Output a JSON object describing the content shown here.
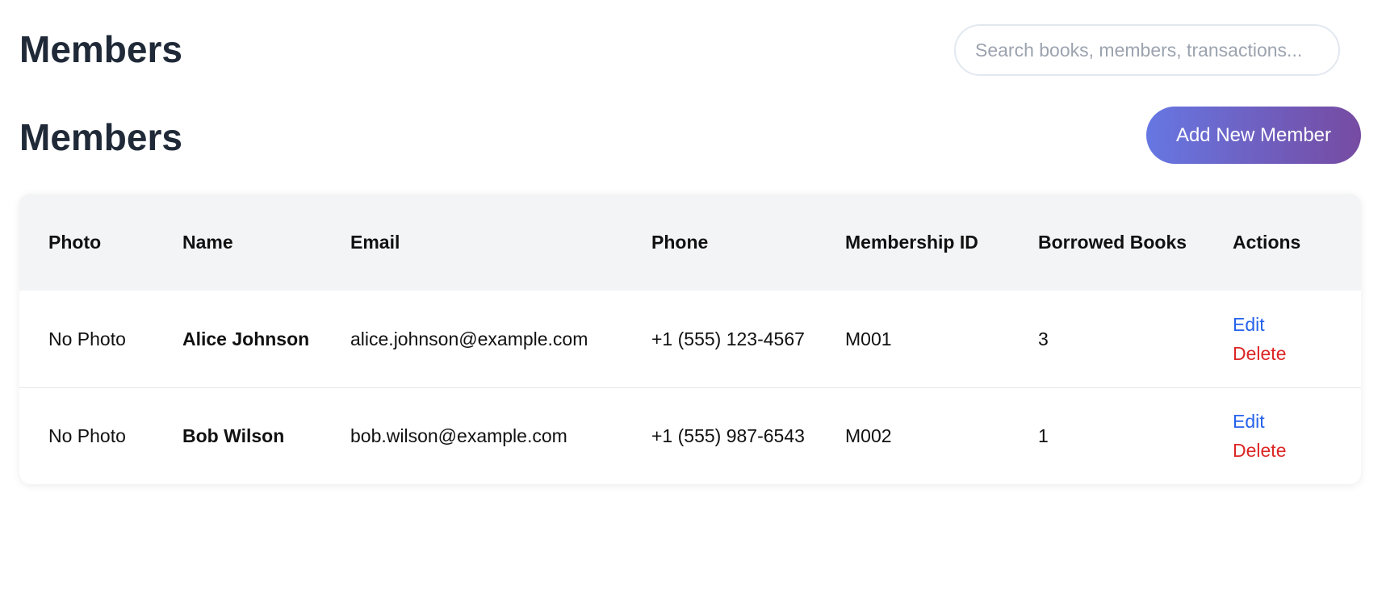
{
  "header": {
    "title": "Members",
    "search_placeholder": "Search books, members, transactions..."
  },
  "section": {
    "title": "Members",
    "add_button_label": "Add New Member"
  },
  "table": {
    "columns": [
      "Photo",
      "Name",
      "Email",
      "Phone",
      "Membership ID",
      "Borrowed Books",
      "Actions"
    ],
    "rows": [
      {
        "photo": "No Photo",
        "name": "Alice Johnson",
        "email": "alice.johnson@example.com",
        "phone": "+1 (555) 123-4567",
        "membership_id": "M001",
        "borrowed_books": "3",
        "edit_label": "Edit",
        "delete_label": "Delete"
      },
      {
        "photo": "No Photo",
        "name": "Bob Wilson",
        "email": "bob.wilson@example.com",
        "phone": "+1 (555) 987-6543",
        "membership_id": "M002",
        "borrowed_books": "1",
        "edit_label": "Edit",
        "delete_label": "Delete"
      }
    ]
  },
  "colors": {
    "title": "#1f2937",
    "edit_link": "#2563eb",
    "delete_link": "#dc2626",
    "button_gradient_start": "#6677e2",
    "button_gradient_end": "#764ba2"
  }
}
